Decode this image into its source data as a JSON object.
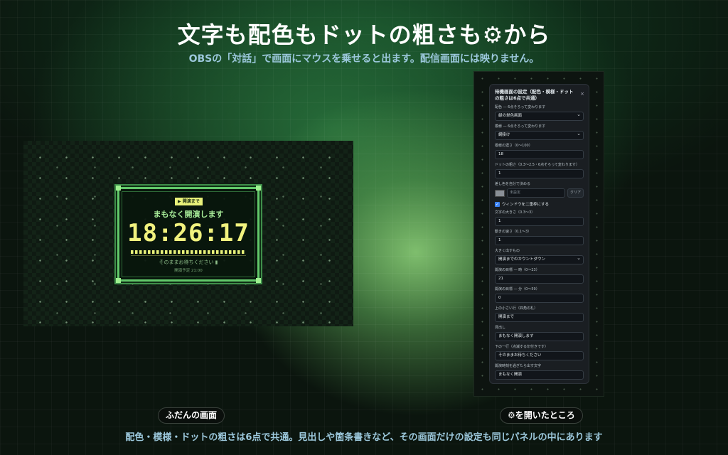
{
  "header": {
    "title": "文字も配色もドットの粗さも⚙から",
    "subtitle": "OBSの「対話」で画面にマウスを乗せると出ます。配信画面には映りません。"
  },
  "preview": {
    "tag": "▶ 開演まで",
    "heading": "まもなく開演します",
    "time": "18:26:17",
    "waiting": "そのままお待ちください ▮",
    "schedule": "開演予定 21:00"
  },
  "panel": {
    "title": "待機画面の設定（配色・模様・ドットの粗さは6点で共通）",
    "close": "×",
    "fields": {
      "palette_label": "配色 — 6点そろって変わります",
      "palette_value": "緑の単色画面",
      "pattern_label": "模様 — 6点そろって変わります",
      "pattern_value": "網掛け",
      "pattern_density_label": "模様の濃さ（0〜100）",
      "pattern_density_value": "18",
      "dot_label": "ドットの粗さ（0.3〜2.5・6点そろって変わります）",
      "dot_value": "1",
      "accent_label": "差し色を自分で決める",
      "accent_placeholder": "未設定",
      "accent_clear": "クリア",
      "double_frame_label": "ウィンドウを二重枠にする",
      "text_size_label": "文字の大きさ（0.3〜3）",
      "text_size_value": "1",
      "speed_label": "動きの速さ（0.1〜3）",
      "speed_value": "1",
      "big_item_label": "大きく出すもの",
      "big_item_value": "開演までのカウントダウン",
      "target_hour_label": "開演の目標 — 時（0〜23）",
      "target_hour_value": "21",
      "target_minute_label": "開演の目標 — 分（0〜59）",
      "target_minute_value": "0",
      "top_small_label": "上の小さい行（四角の札）",
      "top_small_value": "開演まで",
      "heading_label": "見出し",
      "heading_value": "まもなく開演します",
      "bottom_line_label": "下の一行（点滅する印付きです）",
      "bottom_line_value": "そのままお待ちください",
      "after_start_label": "開演時刻を過ぎたら出す文字",
      "after_start_value": "まもなく開演"
    }
  },
  "captions": {
    "left": "ふだんの画面",
    "right": "⚙を開いたところ",
    "footer": "配色・模様・ドットの粗さは6点で共通。見出しや箇条書きなど、その画面だけの設定も同じパネルの中にあります"
  }
}
